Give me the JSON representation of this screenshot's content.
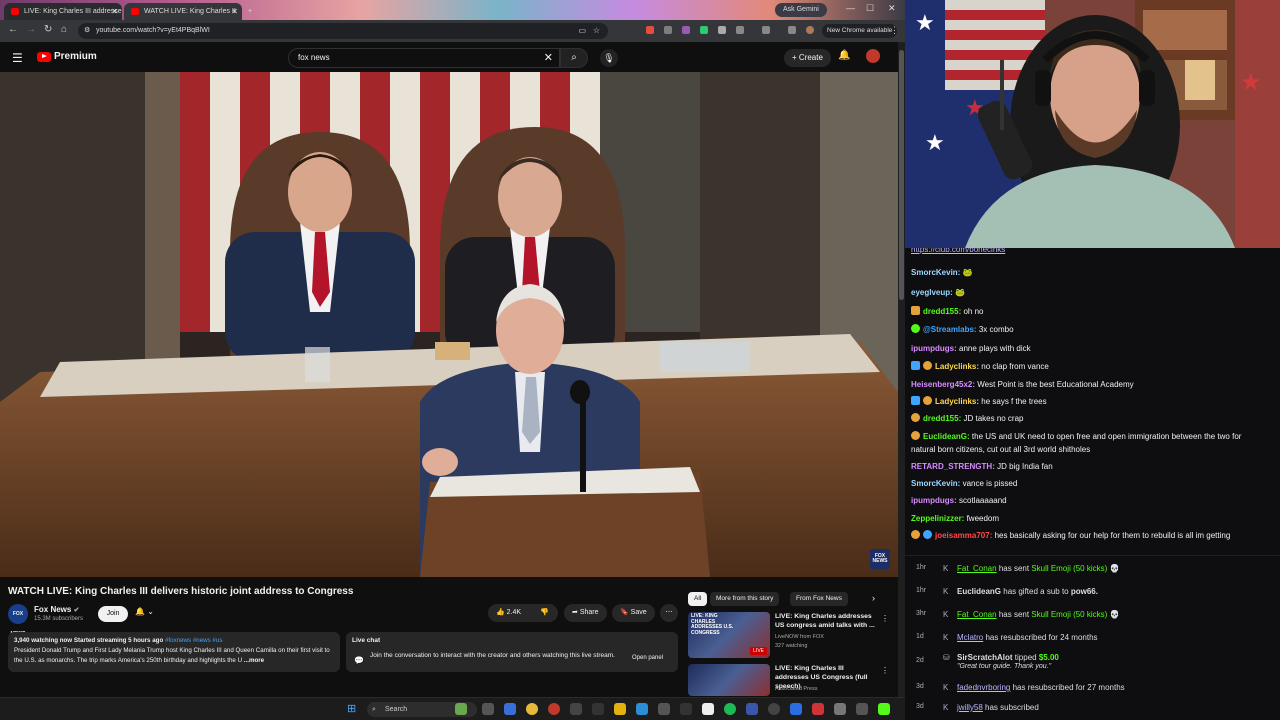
{
  "browser": {
    "tabs": [
      {
        "label": "LIVE: King Charles III addresse"
      },
      {
        "label": "WATCH LIVE: King Charles II"
      }
    ],
    "ask_gemini": "Ask Gemini",
    "url": "youtube.com/watch?v=yEt4PBqBlWI",
    "new_chrome": "New Chrome available"
  },
  "youtube": {
    "brand": "Premium",
    "search_value": "fox news",
    "create_label": "Create",
    "fox_bug": "FOX NEWS",
    "video_title": "WATCH LIVE: King Charles III delivers historic joint address to Congress",
    "channel_name": "Fox News",
    "channel_logo": "FOX NEWS",
    "subscribers": "15.3M subscribers",
    "join_label": "Join",
    "likes": "2.4K",
    "share_label": "Share",
    "save_label": "Save",
    "description": {
      "stats": "3,940 watching now  Started streaming 5 hours ago",
      "tags": "#foxnews #news #us",
      "text": "President Donald Trump and First Lady Melania Trump host King Charles III and Queen Camilla on their first visit to the U.S. as monarchs. The trip marks America's 250th birthday and highlights the U",
      "more": "...more"
    },
    "live_chat": {
      "heading": "Live chat",
      "message": "Join the conversation to interact with the creator and others watching this live stream.",
      "open_panel": "Open panel"
    },
    "chips": [
      "All",
      "More from this story",
      "From Fox News"
    ],
    "related": [
      {
        "thumb_text": "LIVE: KING CHARLES ADDRESSES U.S. CONGRESS",
        "badge": "LIVE",
        "title": "LIVE: King Charles addresses US congress amid talks with ...",
        "channel": "LiveNOW from FOX",
        "meta": "327 watching"
      },
      {
        "title": "LIVE: King Charles III addresses US Congress (full speech)",
        "channel": "Associated Press"
      }
    ]
  },
  "taskbar": {
    "search_label": "Search"
  },
  "stream_chat": {
    "partial_link": "https://club.com/bonecinks",
    "messages": [
      {
        "user": "SmorcKevin:",
        "text": "",
        "color": "#9ed7ff"
      },
      {
        "user": "eyeglveup:",
        "text": "",
        "color": "#9ed7ff"
      },
      {
        "user": "dredd155:",
        "text": "oh no",
        "color": "#53fc18"
      },
      {
        "user": "@Streamlabs:",
        "text": "3x  combo",
        "color": "#3ea6ff"
      },
      {
        "user": "ipumpdugs:",
        "text": "anne plays with dick",
        "color": "#d68cff"
      },
      {
        "user": "Ladyclinks:",
        "text": "no clap from vance",
        "color": "#ffd84d"
      },
      {
        "user": "Heisenberg45x2:",
        "text": "West Point is the best Educational Academy",
        "color": "#d68cff"
      },
      {
        "user": "Ladyclinks:",
        "text": "he says f the trees",
        "color": "#ffd84d"
      },
      {
        "user": "dredd155:",
        "text": "JD takes no crap",
        "color": "#53fc18"
      },
      {
        "user": "EuclideanG:",
        "text": "the US and UK need to open free and open immigration between the two for",
        "color": "#53fc18"
      },
      {
        "user": "",
        "text": "natural born citizens, cut out all 3rd world shitholes",
        "color": "#dedee3"
      },
      {
        "user": "RETARD_STRENGTH:",
        "text": "JD big India fan",
        "color": "#d68cff"
      },
      {
        "user": "SmorcKevin:",
        "text": "vance is pissed",
        "color": "#9ed7ff"
      },
      {
        "user": "ipumpdugs:",
        "text": "scotlaaaaand",
        "color": "#d68cff"
      },
      {
        "user": "Zeppelinizzer:",
        "text": "fweedom",
        "color": "#53fc18"
      },
      {
        "user": "joeisamma707:",
        "text": "hes basically asking for our help for them to rebuild is all im getting",
        "color": "#ff4a4a"
      }
    ]
  },
  "stream_events": [
    {
      "time": "1hr",
      "name": "Fat_Conan",
      "text": " has sent ",
      "item": "Skull Emoji (50 kicks)"
    },
    {
      "time": "1hr",
      "name": "EuclideanG",
      "text": " has gifted a sub to ",
      "item": "pow66."
    },
    {
      "time": "3hr",
      "name": "Fat_Conan",
      "text": " has sent ",
      "item": "Skull Emoji (50 kicks)"
    },
    {
      "time": "1d",
      "name": "Mclatro",
      "text": " has resubscribed for 24 months",
      "item": ""
    },
    {
      "time": "2d",
      "name": "SirScratchAlot",
      "text": " tipped ",
      "item": "$5.00",
      "note": "\"Great tour guide. Thank you.\""
    },
    {
      "time": "3d",
      "name": "fadednvrboring",
      "text": " has resubscribed for 27 months",
      "item": ""
    },
    {
      "time": "3d",
      "name": "jwilly58",
      "text": " has subscribed",
      "item": ""
    }
  ]
}
